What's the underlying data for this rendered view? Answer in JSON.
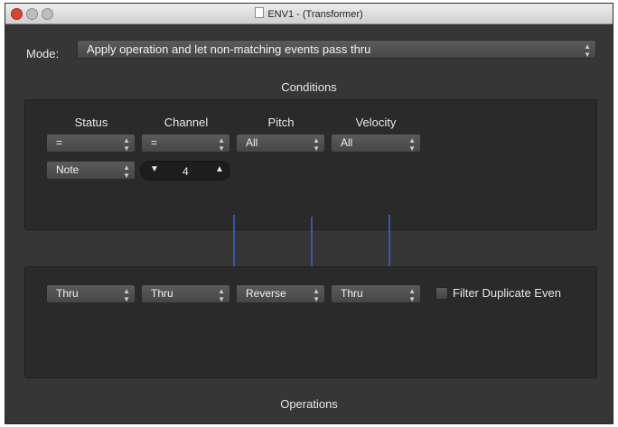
{
  "window": {
    "title": "ENV1 - (Transformer)"
  },
  "mode": {
    "label": "Mode:",
    "value": "Apply operation and let non-matching events pass thru"
  },
  "conditions": {
    "title": "Conditions",
    "columns": [
      "Status",
      "Channel",
      "Pitch",
      "Velocity"
    ],
    "row1": [
      "=",
      "=",
      "All",
      "All"
    ],
    "status_value": "Note",
    "channel_value": "4"
  },
  "operations": {
    "title": "Operations",
    "row": [
      "Thru",
      "Thru",
      "Reverse",
      "Thru"
    ],
    "filter_label": "Filter Duplicate Even"
  },
  "colors": {
    "window_bg": "#363636",
    "panel_bg": "#2a2a2a",
    "connector_line": "#3b56a8"
  }
}
